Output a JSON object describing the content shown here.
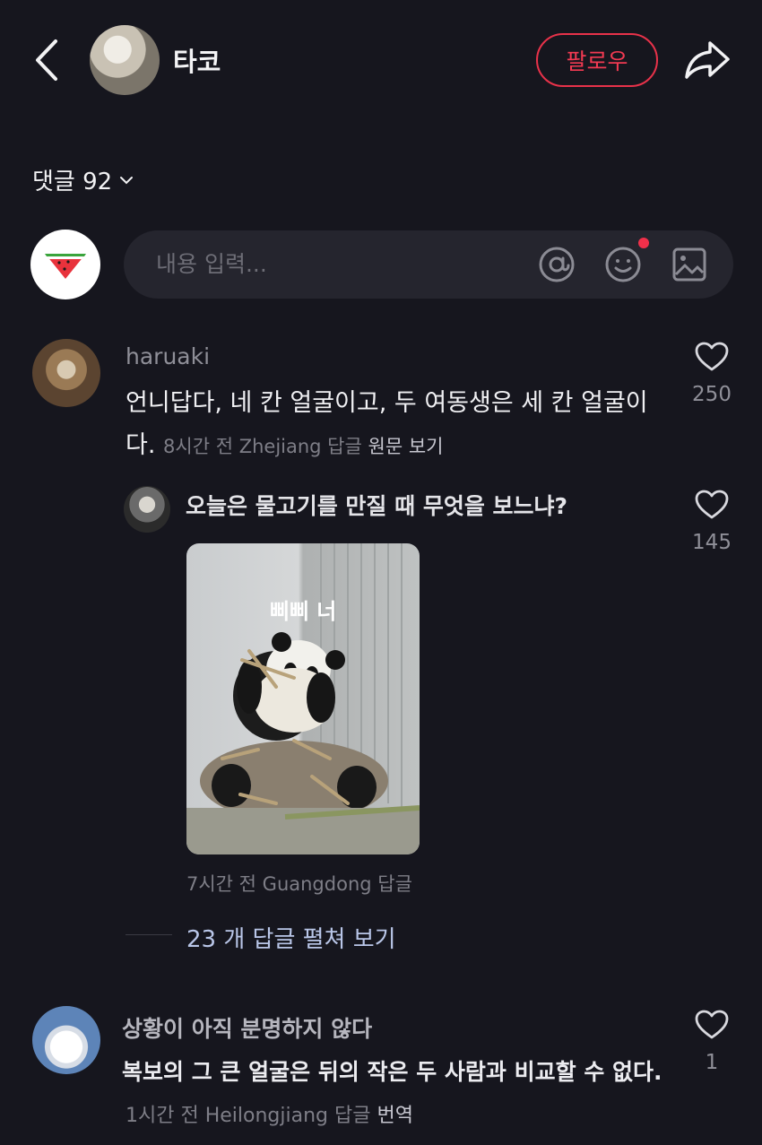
{
  "header": {
    "author_name": "타코",
    "follow_label": "팔로우"
  },
  "comments_header": {
    "label": "댓글 92"
  },
  "input": {
    "placeholder": "내용 입력..."
  },
  "comments": [
    {
      "user": "haruaki",
      "text": "언니답다, 네 칸 얼굴이고, 두 여동생은 세 칸 얼굴이다.",
      "meta": "8시간 전 Zhejiang 답글",
      "action": "원문 보기",
      "likes": "250",
      "reply": {
        "text": "오늘은 물고기를 만질 때 무엇을 보느냐?",
        "image_caption": "삐삐 너",
        "meta": "7시간 전 Guangdong 답글",
        "likes": "145"
      },
      "expand_label": "23 개 답글 펼쳐 보기"
    },
    {
      "user": "상황이 아직 분명하지 않다",
      "text": "복보의 그 큰 얼굴은 뒤의 작은 두 사람과 비교할 수 없다.",
      "meta": "1시간 전 Heilongjiang 답글",
      "action": "번역",
      "likes": "1"
    }
  ],
  "colors": {
    "background": "#16161e",
    "accent": "#f23a52",
    "link": "#b9c6e8"
  },
  "icons": [
    "back-icon",
    "share-icon",
    "chevron-down-icon",
    "at-icon",
    "emoji-icon",
    "image-icon",
    "heart-icon"
  ]
}
